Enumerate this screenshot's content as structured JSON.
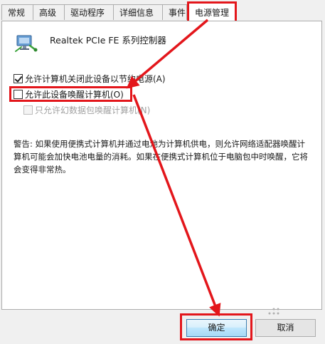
{
  "tabs": [
    {
      "label": "常规"
    },
    {
      "label": "高级"
    },
    {
      "label": "驱动程序"
    },
    {
      "label": "详细信息"
    },
    {
      "label": "事件"
    },
    {
      "label": "电源管理"
    }
  ],
  "device": {
    "name": "Realtek PCIe FE 系列控制器",
    "icon": "network-adapter-icon"
  },
  "options": {
    "allow_turn_off": {
      "label": "允许计算机关闭此设备以节约电源(A)",
      "checked": true
    },
    "allow_wake": {
      "label": "允许此设备唤醒计算机(O)",
      "checked": false
    },
    "magic_packet": {
      "label": "只允许幻数据包唤醒计算机(N)",
      "checked": false,
      "enabled": false
    }
  },
  "warning": "警告: 如果使用便携式计算机并通过电池为计算机供电，则允许网络适配器唤醒计算机可能会加快电池电量的消耗。如果在便携式计算机位于电脑包中时唤醒，它将会变得非常热。",
  "buttons": {
    "ok": "确定",
    "cancel": "取消"
  },
  "annotation_color": "#e3161b"
}
